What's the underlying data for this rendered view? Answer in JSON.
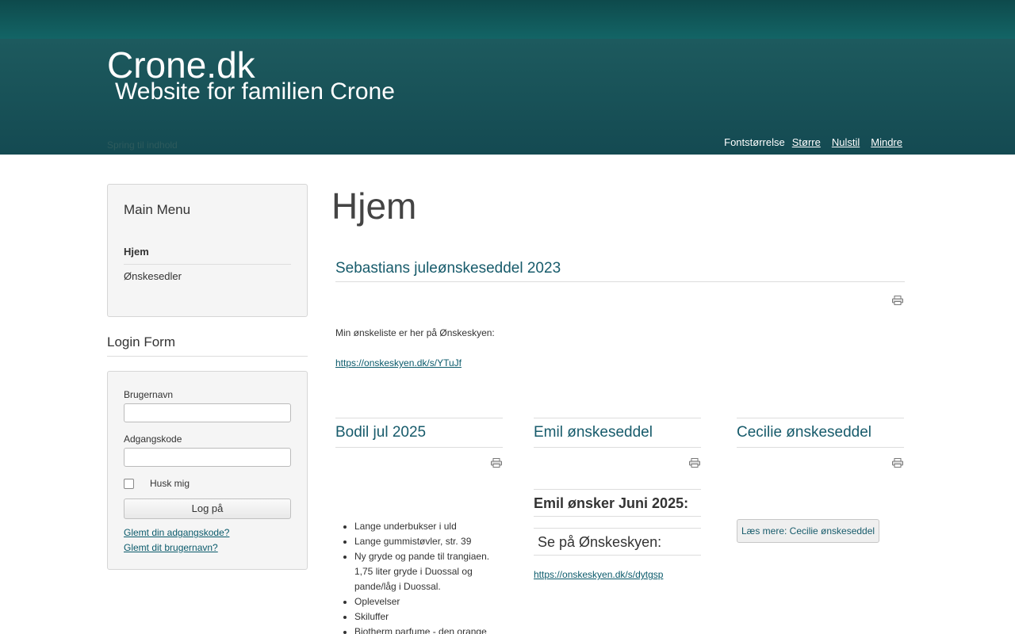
{
  "header": {
    "site_title": "Crone.dk",
    "site_subtitle": "Website for familien Crone",
    "jump_link": "Spring til indhold",
    "fontsize": {
      "label": "Fontstørrelse",
      "bigger": "Større",
      "reset": "Nulstil",
      "smaller": "Mindre"
    }
  },
  "menu": {
    "title": "Main Menu",
    "items": [
      "Hjem",
      "Ønskesedler"
    ]
  },
  "login": {
    "title": "Login Form",
    "username_label": "Brugernavn",
    "username_value": "",
    "password_label": "Adgangskode",
    "password_value": "",
    "remember_label": "Husk mig",
    "submit_label": "Log på",
    "forgot_password": "Glemt din adgangskode?",
    "forgot_username": "Glemt dit brugernavn?"
  },
  "page": {
    "title": "Hjem"
  },
  "featured": {
    "title": "Sebastians juleønskeseddel 2023",
    "text": "Min ønskeliste er her på Ønskeskyen:",
    "link": "https://onskeskyen.dk/s/YTuJf"
  },
  "articles": [
    {
      "title": "Bodil jul 2025",
      "items": [
        "Lange underbukser i uld",
        "Lange gummistøvler, str. 39",
        "Ny gryde og pande til trangiaen. 1,75 liter gryde i Duossal og pande/låg i Duossal.",
        "Oplevelser",
        "Skiluffer",
        "Biotherm parfume - den orange"
      ]
    },
    {
      "title": "Emil ønskeseddel",
      "heading": "Emil ønsker Juni 2025:",
      "subheading": "Se på Ønskeskyen:",
      "link": "https://onskeskyen.dk/s/dytgsp"
    },
    {
      "title": "Cecilie ønskeseddel",
      "readmore": "Læs mere: Cecilie ønskeseddel"
    }
  ],
  "icons": {
    "print": "printer-icon"
  }
}
